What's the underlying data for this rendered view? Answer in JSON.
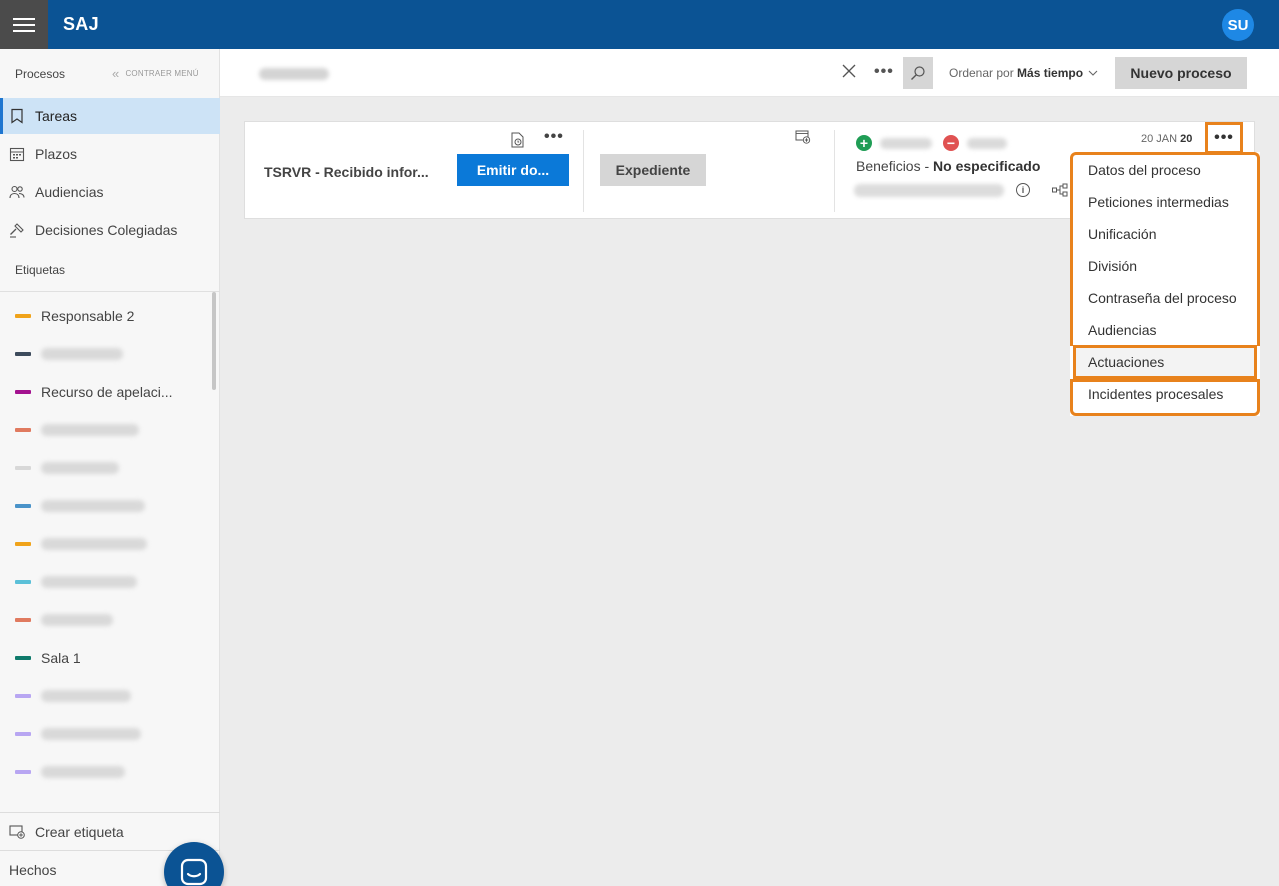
{
  "topbar": {
    "app_title": "SAJ",
    "avatar_initials": "SU",
    "menu_icon": "hamburger-icon"
  },
  "sidebar": {
    "header": "Procesos",
    "collapse_label": "CONTRAER MENÚ",
    "nav": [
      {
        "label": "Tareas",
        "icon": "bookmark-icon",
        "active": true
      },
      {
        "label": "Plazos",
        "icon": "calendar-icon",
        "active": false
      },
      {
        "label": "Audiencias",
        "icon": "people-icon",
        "active": false
      },
      {
        "label": "Decisiones Colegiadas",
        "icon": "gavel-icon",
        "active": false
      }
    ],
    "tags_header": "Etiquetas",
    "tags": [
      {
        "label": "Responsable 2",
        "color": "#f0a31a"
      },
      {
        "label": "",
        "color": "#3d4b5c"
      },
      {
        "label": "Recurso de apelaci...",
        "color": "#a3128f"
      },
      {
        "label": "",
        "color": "#e07a5f"
      },
      {
        "label": "",
        "color": "#d8d8d8"
      },
      {
        "label": "",
        "color": "#4a93c9"
      },
      {
        "label": "",
        "color": "#f0a31a"
      },
      {
        "label": "",
        "color": "#5bc0d8"
      },
      {
        "label": "",
        "color": "#e07a5f"
      },
      {
        "label": "Sala 1",
        "color": "#0f7a6b"
      },
      {
        "label": "",
        "color": "#b8a6f2"
      },
      {
        "label": "",
        "color": "#b8a6f2"
      },
      {
        "label": "",
        "color": "#b8a6f2"
      }
    ],
    "create_tag": "Crear etiqueta",
    "footer_item": "Hechos"
  },
  "toolbar": {
    "search_placeholder": "",
    "order_by_prefix": "Ordenar por",
    "order_by_value": "Más tiempo",
    "new_process_label": "Nuevo proceso"
  },
  "card": {
    "title": "TSRVR - Recibido infor...",
    "emit_label": "Emitir do...",
    "expediente_label": "Expediente",
    "benefits_label": "Beneficios -",
    "benefits_value": "No especificado",
    "date_prefix": "20 JAN",
    "date_year": "20"
  },
  "menu": {
    "items": [
      "Datos del proceso",
      "Peticiones intermedias",
      "Unificación",
      "División",
      "Contraseña del proceso",
      "Audiencias",
      "Actuaciones",
      "Incidentes procesales"
    ]
  },
  "colors": {
    "topbar": "#0b5394",
    "primary_button": "#0b79d8",
    "highlight": "#e8821c",
    "active_nav": "#cde3f6"
  }
}
